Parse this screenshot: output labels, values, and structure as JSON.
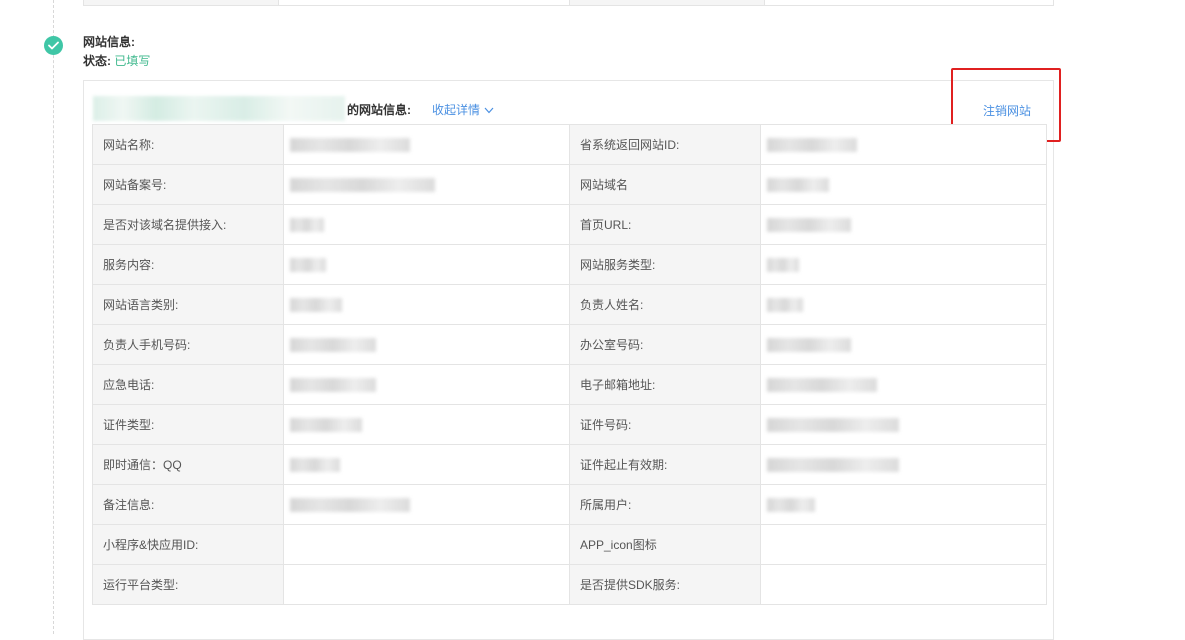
{
  "step": {
    "title": "网站信息:",
    "status_label": "状态:",
    "status_value": "已填写",
    "icon": "check-icon",
    "icon_color": "#3fc6a6"
  },
  "panel": {
    "header_label": "的网站信息:",
    "collapse_label": "收起详情",
    "cancel_label": "注销网站",
    "link_color": "#4a90e2",
    "highlight_color": "#e02020"
  },
  "rows": [
    {
      "left_label": "网站名称:",
      "right_label": "省系统返回网站ID:"
    },
    {
      "left_label": "网站备案号:",
      "right_label": "网站域名"
    },
    {
      "left_label": "是否对该域名提供接入:",
      "right_label": "首页URL:"
    },
    {
      "left_label": "服务内容:",
      "right_label": "网站服务类型:"
    },
    {
      "left_label": "网站语言类别:",
      "right_label": "负责人姓名:"
    },
    {
      "left_label": "负责人手机号码:",
      "right_label": "办公室号码:"
    },
    {
      "left_label": "应急电话:",
      "right_label": "电子邮箱地址:"
    },
    {
      "left_label": "证件类型:",
      "right_label": "证件号码:"
    },
    {
      "left_label": "即时通信：QQ",
      "right_label": "证件起止有效期:"
    },
    {
      "left_label": "备注信息:",
      "right_label": "所属用户:"
    },
    {
      "left_label": "小程序&快应用ID:",
      "right_label": "APP_icon图标"
    },
    {
      "left_label": "运行平台类型:",
      "right_label": "是否提供SDK服务:"
    }
  ]
}
